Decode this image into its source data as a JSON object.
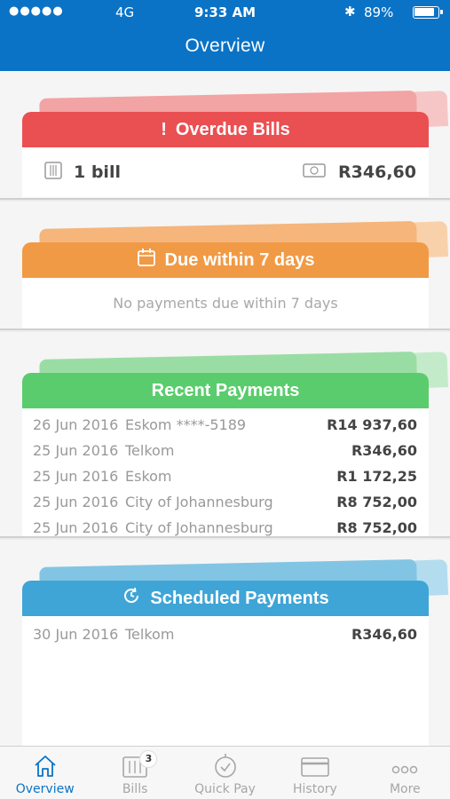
{
  "status": {
    "signal": "●●●●●",
    "network": "4G",
    "time": "9:33 AM",
    "bluetooth": "✱",
    "battery": "89%"
  },
  "header": {
    "title": "Overview"
  },
  "overdue": {
    "title": "Overdue Bills",
    "count": "1 bill",
    "amount": "R346,60",
    "color": "#ea4f52"
  },
  "due": {
    "title": "Due within 7 days",
    "empty": "No payments due within 7 days",
    "color": "#f19a45"
  },
  "recent": {
    "title": "Recent Payments",
    "color": "#5bcc6d",
    "rows": [
      {
        "date": "26 Jun 2016",
        "payee": "Eskom ****-5189",
        "amount": "R14 937,60"
      },
      {
        "date": "25 Jun 2016",
        "payee": "Telkom",
        "amount": "R346,60"
      },
      {
        "date": "25 Jun 2016",
        "payee": "Eskom",
        "amount": "R1 172,25"
      },
      {
        "date": "25 Jun 2016",
        "payee": "City of Johannesburg",
        "amount": "R8 752,00"
      },
      {
        "date": "25 Jun 2016",
        "payee": "City of Johannesburg",
        "amount": "R8 752,00"
      }
    ]
  },
  "scheduled": {
    "title": "Scheduled Payments",
    "color": "#3fa5d6",
    "rows": [
      {
        "date": "30 Jun 2016",
        "payee": "Telkom",
        "amount": "R346,60"
      }
    ]
  },
  "tabs": {
    "overview": "Overview",
    "bills": "Bills",
    "bills_badge": "3",
    "quickpay": "Quick Pay",
    "history": "History",
    "more": "More"
  }
}
